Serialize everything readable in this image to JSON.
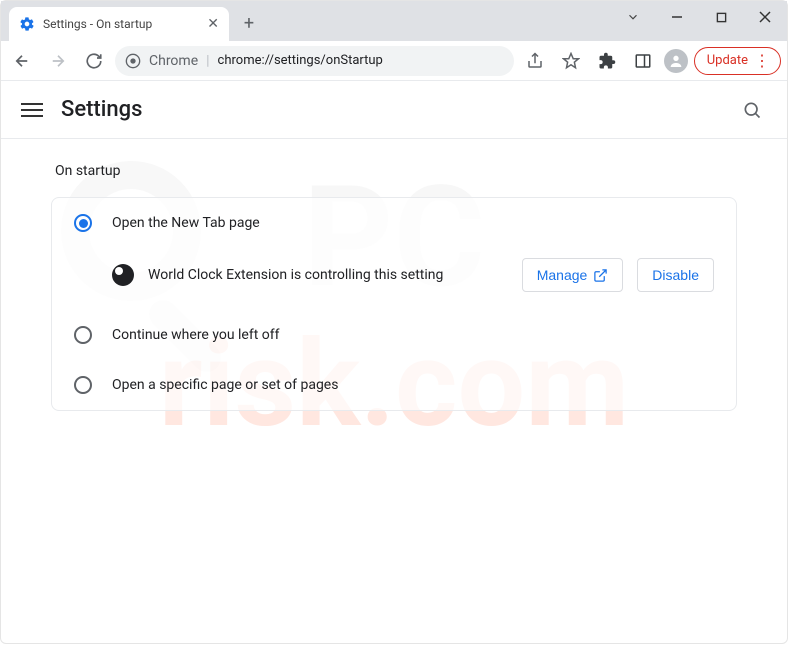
{
  "window": {
    "tab_title": "Settings - On startup"
  },
  "toolbar": {
    "chrome_label": "Chrome",
    "url": "chrome://settings/onStartup",
    "update_label": "Update"
  },
  "settings": {
    "title": "Settings",
    "section": "On startup",
    "options": [
      {
        "label": "Open the New Tab page",
        "selected": true
      },
      {
        "label": "Continue where you left off",
        "selected": false
      },
      {
        "label": "Open a specific page or set of pages",
        "selected": false
      }
    ],
    "extension_notice": "World Clock Extension is controlling this setting",
    "manage_label": "Manage",
    "disable_label": "Disable"
  }
}
